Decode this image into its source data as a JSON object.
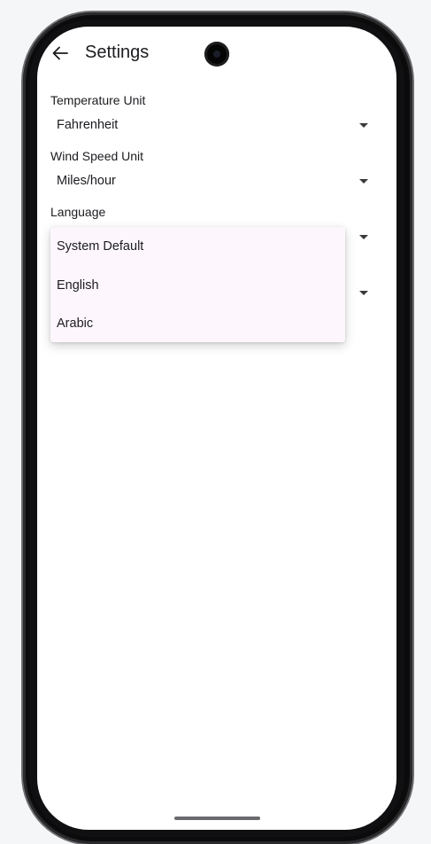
{
  "app_bar": {
    "back_icon": "arrow-left-icon",
    "title": "Settings"
  },
  "settings": {
    "temperature": {
      "label": "Temperature Unit",
      "value": "Fahrenheit"
    },
    "wind_speed": {
      "label": "Wind Speed Unit",
      "value": "Miles/hour"
    },
    "language": {
      "label": "Language",
      "value": ""
    }
  },
  "language_menu": {
    "items": [
      {
        "label": "System Default"
      },
      {
        "label": "English"
      },
      {
        "label": "Arabic"
      }
    ]
  },
  "colors": {
    "menu_background": "#fdf7fd",
    "screen_background": "#ffffff",
    "text": "#1c1b1f"
  }
}
